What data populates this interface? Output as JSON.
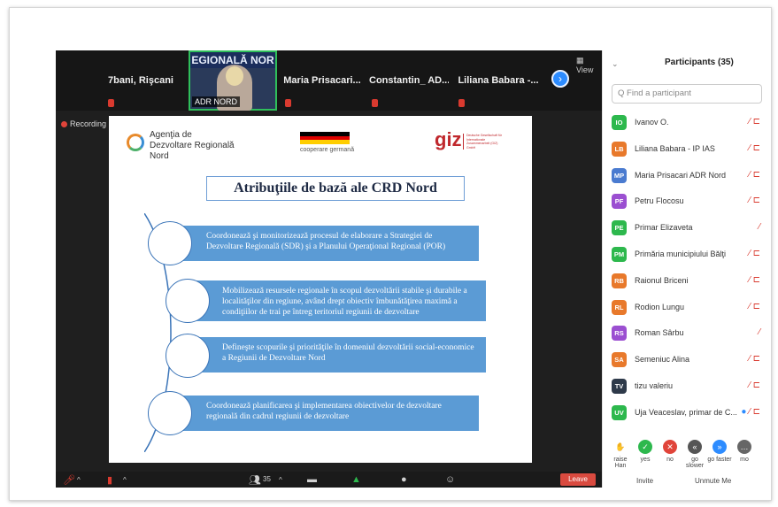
{
  "strip": {
    "tiles": [
      "7bani, Rişcani",
      "Maria Prisacari...",
      "Constantin_ AD...",
      "Liliana Babara -..."
    ],
    "video_banner": "EGIONALĂ NOR",
    "video_label": "ADR NORD",
    "view_label": "View",
    "next_icon": "chevron-right-icon"
  },
  "recording_label": "Recording",
  "slide": {
    "agency_name": [
      "Agenţia de",
      "Dezvoltare Regională",
      "Nord"
    ],
    "coop_text": "cooperare germană",
    "giz_label": "giz",
    "giz_subtext": "Deutsche Gesellschaft für Internationale Zusammenarbeit (GIZ) GmbH",
    "title": "Atribuţiile de bază ale  CRD Nord",
    "items": [
      "Coordonează şi monitorizează procesul de elaborare a Strategiei de Dezvoltare Regională (SDR) şi a Planului Operaţional Regional (POR)",
      "Mobilizează resursele regionale în scopul dezvoltării stabile şi durabile a localităţilor din regiune, având drept obiectiv îmbunătăţirea maximă a condiţiilor de trai pe întreg teritoriul regiunii de dezvoltare",
      "Defineşte scopurile şi priorităţile în domeniul dezvoltării social-economice a Regiunii de Dezvoltare Nord",
      "Coordonează planificarea şi implementarea obiectivelor de dezvoltare regională din cadrul regiunii de dezvoltare"
    ]
  },
  "toolbar": {
    "participants_count": "35",
    "leave_label": "Leave"
  },
  "panel": {
    "title": "Participants (35)",
    "search_placeholder": "Find a participant",
    "participants": [
      {
        "initials": "IO",
        "name": "Ivanov O.",
        "color": "#2db84d"
      },
      {
        "initials": "LB",
        "name": "Liliana Babara - IP IAS",
        "color": "#e8792b"
      },
      {
        "initials": "MP",
        "name": "Maria Prisacari ADR Nord",
        "color": "#4a7bd0"
      },
      {
        "initials": "PF",
        "name": "Petru Flocosu",
        "color": "#9b4fd1"
      },
      {
        "initials": "PE",
        "name": "Primar Elizaveta",
        "color": "#2db84d"
      },
      {
        "initials": "PM",
        "name": "Primăria municipiului Bălţi",
        "color": "#2db84d"
      },
      {
        "initials": "RB",
        "name": "Raionul Briceni",
        "color": "#e8792b"
      },
      {
        "initials": "RL",
        "name": "Rodion Lungu",
        "color": "#e8792b"
      },
      {
        "initials": "RS",
        "name": "Roman Sârbu",
        "color": "#9b4fd1"
      },
      {
        "initials": "SA",
        "name": "Semeniuc Alina",
        "color": "#e8792b"
      },
      {
        "initials": "TV",
        "name": "tizu valeriu",
        "color": "#2e3a4a"
      },
      {
        "initials": "UV",
        "name": "Uja Veaceslav, primar de C...",
        "color": "#2db84d"
      }
    ],
    "reactions": [
      {
        "label": "raise Han",
        "color": "#2d8cff",
        "glyph": "✋"
      },
      {
        "label": "yes",
        "color": "#2db84d",
        "glyph": "✓"
      },
      {
        "label": "no",
        "color": "#e0443a",
        "glyph": "✕"
      },
      {
        "label": "go slower",
        "color": "#555",
        "glyph": "«"
      },
      {
        "label": "go faster",
        "color": "#2d8cff",
        "glyph": "»"
      },
      {
        "label": "mo",
        "color": "#666",
        "glyph": "…"
      }
    ],
    "invite_label": "Invite",
    "mute_label": "Unmute Me"
  }
}
